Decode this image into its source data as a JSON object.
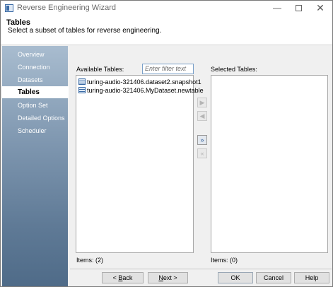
{
  "window": {
    "title": "Reverse Engineering Wizard"
  },
  "header": {
    "title": "Tables",
    "subtitle": "Select a subset of tables for reverse engineering."
  },
  "sidebar": {
    "items": [
      {
        "label": "Overview",
        "active": false
      },
      {
        "label": "Connection",
        "active": false
      },
      {
        "label": "Datasets",
        "active": false
      },
      {
        "label": "Tables",
        "active": true
      },
      {
        "label": "Option Set",
        "active": false
      },
      {
        "label": "Detailed Options",
        "active": false
      },
      {
        "label": "Scheduler",
        "active": false
      }
    ]
  },
  "available": {
    "label": "Available Tables:",
    "filter_placeholder": "Enter filter text",
    "items": [
      "turing-audio-321406.dataset2.snapshot1",
      "turing-audio-321406.MyDataset.newtable"
    ],
    "count_label": "Items: (2)"
  },
  "selected": {
    "label": "Selected Tables:",
    "items": [],
    "count_label": "Items: (0)"
  },
  "move_buttons": [
    {
      "icon": "move-right-icon",
      "enabled": false
    },
    {
      "icon": "move-left-icon",
      "enabled": false
    },
    {
      "icon": "move-all-right-icon",
      "enabled": true
    },
    {
      "icon": "move-all-left-icon",
      "enabled": false
    }
  ],
  "buttons": {
    "back": {
      "accel": "B",
      "rest": "ack",
      "prefix": "< "
    },
    "next": {
      "accel": "N",
      "rest": "ext",
      "suffix": " >"
    },
    "ok": "OK",
    "cancel": "Cancel",
    "help": "Help"
  }
}
